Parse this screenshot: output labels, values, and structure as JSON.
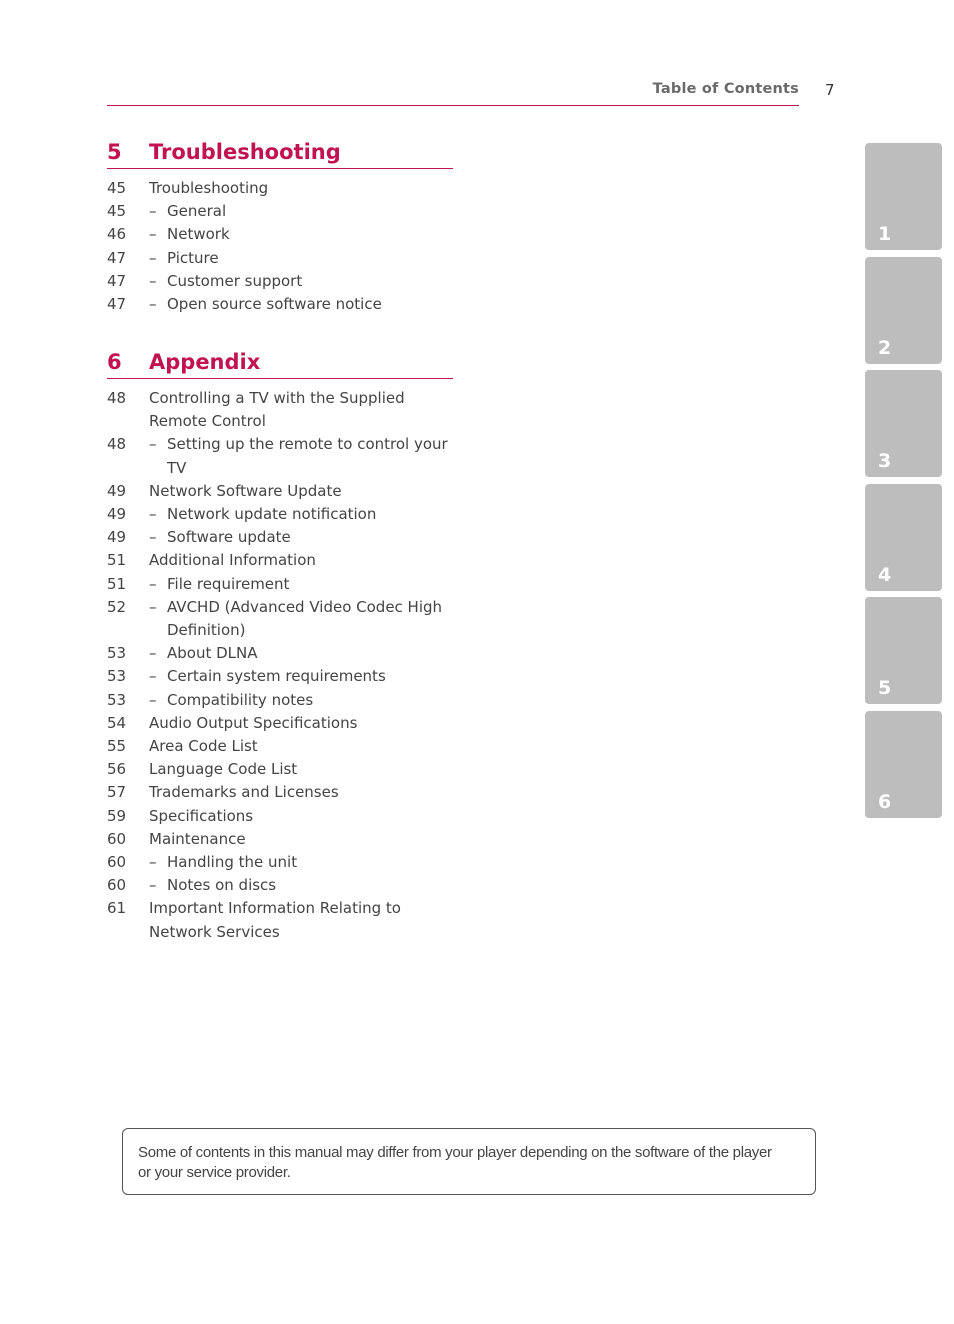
{
  "header": {
    "title": "Table of Contents",
    "page_number": "7"
  },
  "sections": [
    {
      "number": "5",
      "title": "Troubleshooting",
      "entries": [
        {
          "page": "45",
          "text": "Troubleshooting",
          "sub": false
        },
        {
          "page": "45",
          "text": "General",
          "sub": true
        },
        {
          "page": "46",
          "text": "Network",
          "sub": true
        },
        {
          "page": "47",
          "text": "Picture",
          "sub": true
        },
        {
          "page": "47",
          "text": "Customer support",
          "sub": true
        },
        {
          "page": "47",
          "text": "Open source software notice",
          "sub": true
        }
      ]
    },
    {
      "number": "6",
      "title": "Appendix",
      "entries": [
        {
          "page": "48",
          "text": "Controlling a TV with the Supplied Remote Control",
          "sub": false
        },
        {
          "page": "48",
          "text": "Setting up the remote to control your TV",
          "sub": true
        },
        {
          "page": "49",
          "text": "Network Software Update",
          "sub": false
        },
        {
          "page": "49",
          "text": "Network update notification",
          "sub": true
        },
        {
          "page": "49",
          "text": "Software update",
          "sub": true
        },
        {
          "page": "51",
          "text": "Additional Information",
          "sub": false
        },
        {
          "page": "51",
          "text": "File requirement",
          "sub": true
        },
        {
          "page": "52",
          "text": "AVCHD (Advanced Video Codec High Definition)",
          "sub": true
        },
        {
          "page": "53",
          "text": "About DLNA",
          "sub": true
        },
        {
          "page": "53",
          "text": "Certain system requirements",
          "sub": true
        },
        {
          "page": "53",
          "text": "Compatibility notes",
          "sub": true
        },
        {
          "page": "54",
          "text": "Audio Output Specifications",
          "sub": false
        },
        {
          "page": "55",
          "text": "Area Code List",
          "sub": false
        },
        {
          "page": "56",
          "text": "Language Code List",
          "sub": false
        },
        {
          "page": "57",
          "text": "Trademarks and Licenses",
          "sub": false
        },
        {
          "page": "59",
          "text": "Specifications",
          "sub": false
        },
        {
          "page": "60",
          "text": "Maintenance",
          "sub": false
        },
        {
          "page": "60",
          "text": "Handling the unit",
          "sub": true
        },
        {
          "page": "60",
          "text": "Notes on discs",
          "sub": true
        },
        {
          "page": "61",
          "text": "Important Information Relating to Network Services",
          "sub": false
        }
      ]
    }
  ],
  "chapter_tabs": [
    "1",
    "2",
    "3",
    "4",
    "5",
    "6"
  ],
  "notice": "Some of contents in this manual may differ from your player depending on the software of the player or your service provider.",
  "dash": "–",
  "colors": {
    "accent": "#c0134f",
    "tab": "#bdbdbd"
  }
}
